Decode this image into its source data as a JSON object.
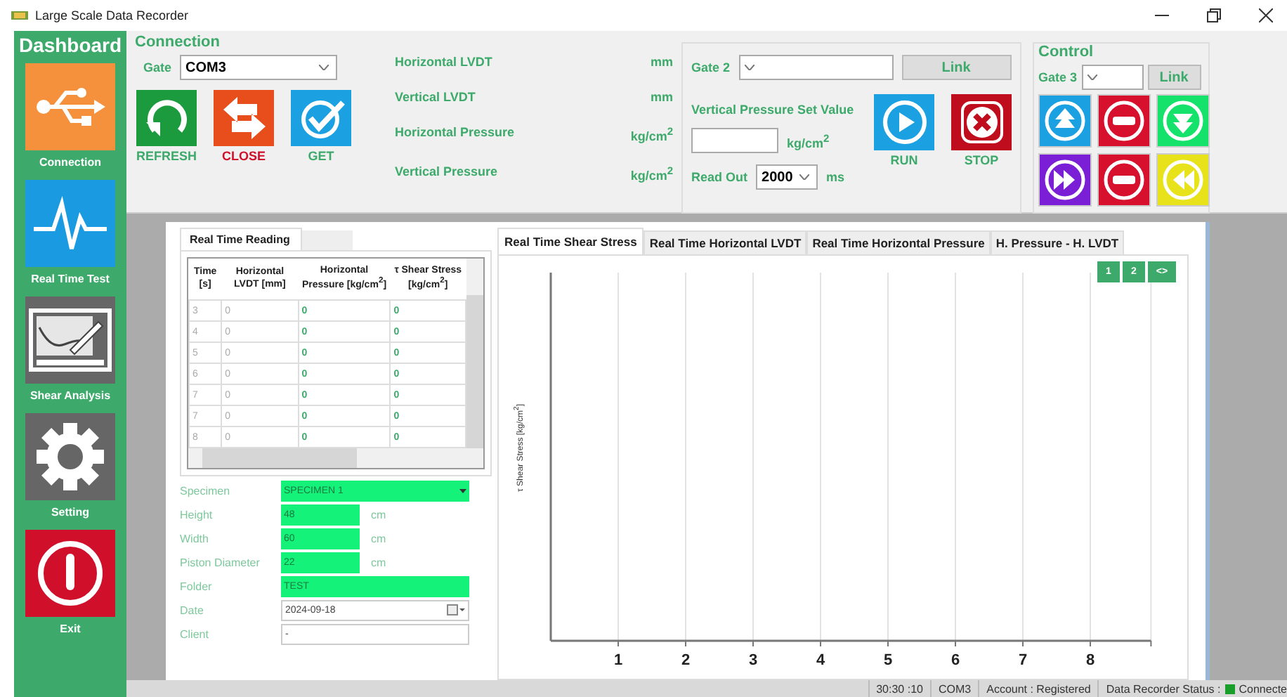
{
  "window": {
    "title": "Large Scale Data Recorder"
  },
  "sidebar": {
    "title": "Dashboard",
    "items": [
      {
        "label": "Connection",
        "kind": "usb",
        "color": "#f5903d"
      },
      {
        "label": "Real Time Test",
        "kind": "pulse",
        "color": "#1a9ae0"
      },
      {
        "label": "Shear Analysis",
        "kind": "analysis",
        "color": "#666666"
      },
      {
        "label": "Setting",
        "kind": "gear",
        "color": "#666666"
      },
      {
        "label": "Exit",
        "kind": "power",
        "color": "#d0102a"
      }
    ]
  },
  "connection": {
    "title": "Connection",
    "gate_label": "Gate",
    "gate_value": "COM3",
    "buttons": [
      {
        "label": "REFRESH",
        "kind": "refresh",
        "color": "#1b9a3e"
      },
      {
        "label": "CLOSE",
        "kind": "swap",
        "color": "#e84e1b"
      },
      {
        "label": "GET",
        "kind": "check",
        "color": "#1ba1e2"
      }
    ]
  },
  "readings": [
    {
      "label": "Horizontal LVDT",
      "unit": "mm"
    },
    {
      "label": "Vertical LVDT",
      "unit": "mm"
    },
    {
      "label": "Horizontal Pressure",
      "unit": "kg/cm$^{2}$"
    },
    {
      "label": "Vertical Pressure",
      "unit": "kg/cm$^{2}$"
    }
  ],
  "gate2": {
    "label": "Gate 2",
    "link": "Link",
    "set_label": "Vertical Pressure Set Value",
    "set_unit": "kg/cm$^{2}$",
    "readout_label": "Read Out",
    "readout_value": "2000",
    "readout_unit": "ms",
    "buttons": [
      {
        "label": "RUN",
        "kind": "run",
        "color": "#1ba1e2"
      },
      {
        "label": "STOP",
        "kind": "stop",
        "color": "#c00d1e"
      }
    ]
  },
  "control": {
    "title": "Control",
    "gate_label": "Gate 3",
    "link": "Link",
    "buttons": [
      {
        "kind": "up",
        "color": "#1ba1e2"
      },
      {
        "kind": "halt",
        "color": "#d7102e"
      },
      {
        "kind": "down",
        "color": "#14e26a"
      },
      {
        "kind": "forward",
        "color": "#7a1fd6"
      },
      {
        "kind": "halt",
        "color": "#d7102e"
      },
      {
        "kind": "back",
        "color": "#e8e21a"
      }
    ]
  },
  "reading_panel": {
    "tab": "Real Time Reading",
    "columns": [
      "Time [s]",
      "Horizontal LVDT [mm]",
      "Horizontal Pressure [kg/cm$^{2}$]",
      "τ Shear Stress [kg/cm$^{2}$]"
    ],
    "rows": [
      [
        "3",
        "0",
        "0",
        "0"
      ],
      [
        "4",
        "0",
        "0",
        "0"
      ],
      [
        "5",
        "0",
        "0",
        "0"
      ],
      [
        "6",
        "0",
        "0",
        "0"
      ],
      [
        "7",
        "0",
        "0",
        "0"
      ],
      [
        "7",
        "0",
        "0",
        "0"
      ],
      [
        "8",
        "0",
        "0",
        "0"
      ]
    ]
  },
  "specimen": [
    {
      "label": "Specimen",
      "value": "SPECIMEN 1",
      "kind": "dropdown"
    },
    {
      "label": "Height",
      "value": "48",
      "unit": "cm",
      "kind": "short"
    },
    {
      "label": "Width",
      "value": "60",
      "unit": "cm",
      "kind": "short"
    },
    {
      "label": "Piston Diameter",
      "value": "22",
      "unit": "cm",
      "kind": "short"
    },
    {
      "label": "Folder",
      "value": "TEST",
      "kind": "wide"
    },
    {
      "label": "Date",
      "value": "2024-09-18",
      "kind": "date"
    },
    {
      "label": "Client",
      "value": "-",
      "kind": "text"
    }
  ],
  "chart_tabs": [
    {
      "label": "Real Time Shear Stress",
      "selected": true
    },
    {
      "label": "Real Time Horizontal LVDT",
      "selected": false
    },
    {
      "label": "Real Time Horizontal Pressure",
      "selected": false
    },
    {
      "label": "H. Pressure - H. LVDT",
      "selected": false
    }
  ],
  "chart_pager": [
    "1",
    "2",
    "<>"
  ],
  "chart": {
    "ylabel": "τ Shear Stress [kg/cm$^{2}$]",
    "x_ticks": [
      "1",
      "2",
      "3",
      "4",
      "5",
      "6",
      "7",
      "8"
    ]
  },
  "status_bar": {
    "items": [
      "30:30 :10",
      "COM3",
      "Account : Registered"
    ],
    "status_label": "Data Recorder Status :",
    "connected": true,
    "status_text": "Connecte"
  }
}
